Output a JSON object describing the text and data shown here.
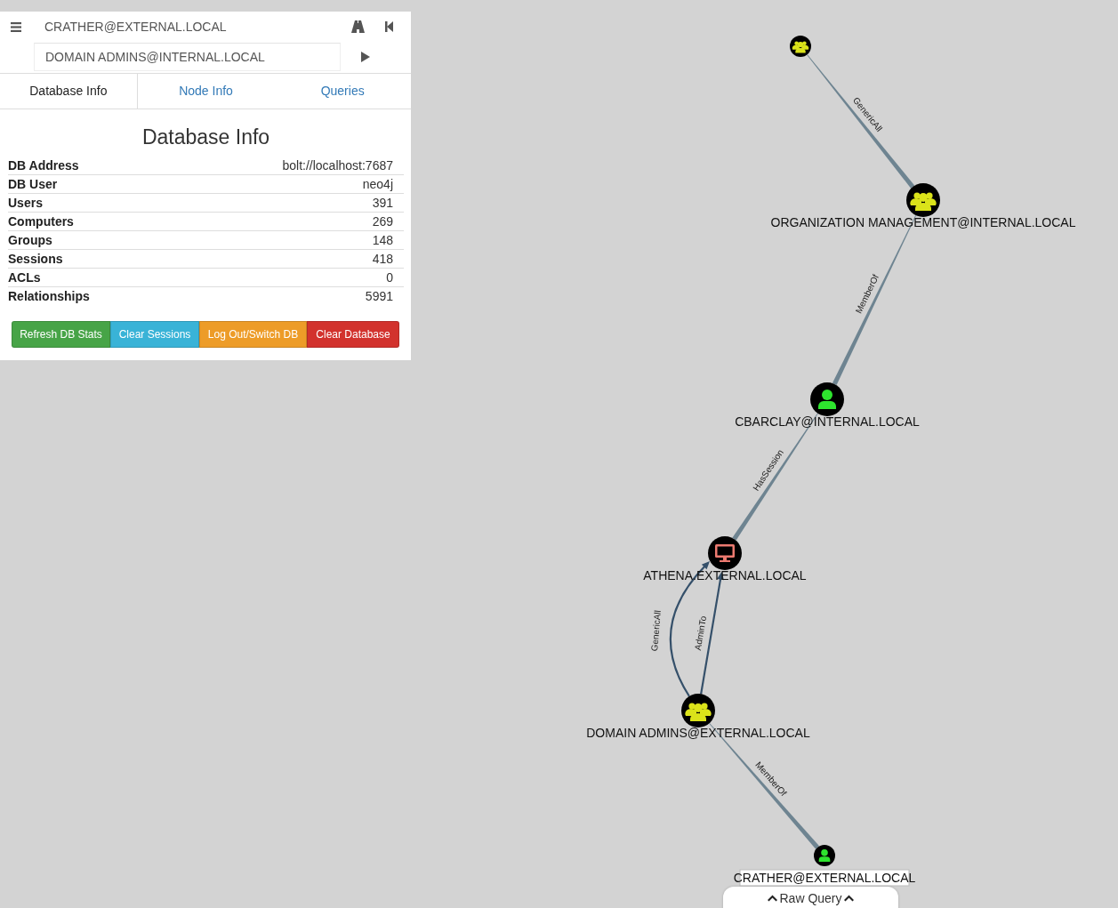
{
  "search": {
    "start": "CRATHER@EXTERNAL.LOCAL",
    "target": "DOMAIN ADMINS@INTERNAL.LOCAL"
  },
  "tabs": [
    {
      "label": "Database Info",
      "selected": true
    },
    {
      "label": "Node Info",
      "selected": false
    },
    {
      "label": "Queries",
      "selected": false
    }
  ],
  "panel_title": "Database Info",
  "stats": [
    {
      "label": "DB Address",
      "value": "bolt://localhost:7687"
    },
    {
      "label": "DB User",
      "value": "neo4j"
    },
    {
      "label": "Users",
      "value": "391"
    },
    {
      "label": "Computers",
      "value": "269"
    },
    {
      "label": "Groups",
      "value": "148"
    },
    {
      "label": "Sessions",
      "value": "418"
    },
    {
      "label": "ACLs",
      "value": "0"
    },
    {
      "label": "Relationships",
      "value": "5991"
    }
  ],
  "buttons": [
    {
      "label": "Refresh DB Stats",
      "kind": "success"
    },
    {
      "label": "Clear Sessions",
      "kind": "info"
    },
    {
      "label": "Log Out/Switch DB",
      "kind": "warning"
    },
    {
      "label": "Clear Database",
      "kind": "danger"
    }
  ],
  "graph": {
    "nodes": [
      {
        "kind": "group",
        "highlighted": false
      },
      {
        "kind": "group",
        "label": "ORGANIZATION MANAGEMENT@INTERNAL.LOCAL",
        "highlighted": false
      },
      {
        "kind": "user",
        "label": "CBARCLAY@INTERNAL.LOCAL",
        "highlighted": false
      },
      {
        "kind": "computer",
        "label": "ATHENA.EXTERNAL.LOCAL",
        "highlighted": false
      },
      {
        "kind": "group",
        "label": "DOMAIN ADMINS@EXTERNAL.LOCAL",
        "highlighted": false
      },
      {
        "kind": "user",
        "label": "CRATHER@EXTERNAL.LOCAL",
        "highlighted": true
      }
    ],
    "edges": [
      {
        "label": "GenericAll",
        "kind": "tapered"
      },
      {
        "label": "MemberOf",
        "kind": "tapered"
      },
      {
        "label": "HasSession",
        "kind": "tapered"
      },
      {
        "label": "GenericAll",
        "kind": "curved-arrow"
      },
      {
        "label": "AdminTo",
        "kind": "arrow"
      },
      {
        "label": "MemberOf",
        "kind": "tapered"
      }
    ]
  },
  "raw_query": {
    "label": "Raw Query"
  }
}
